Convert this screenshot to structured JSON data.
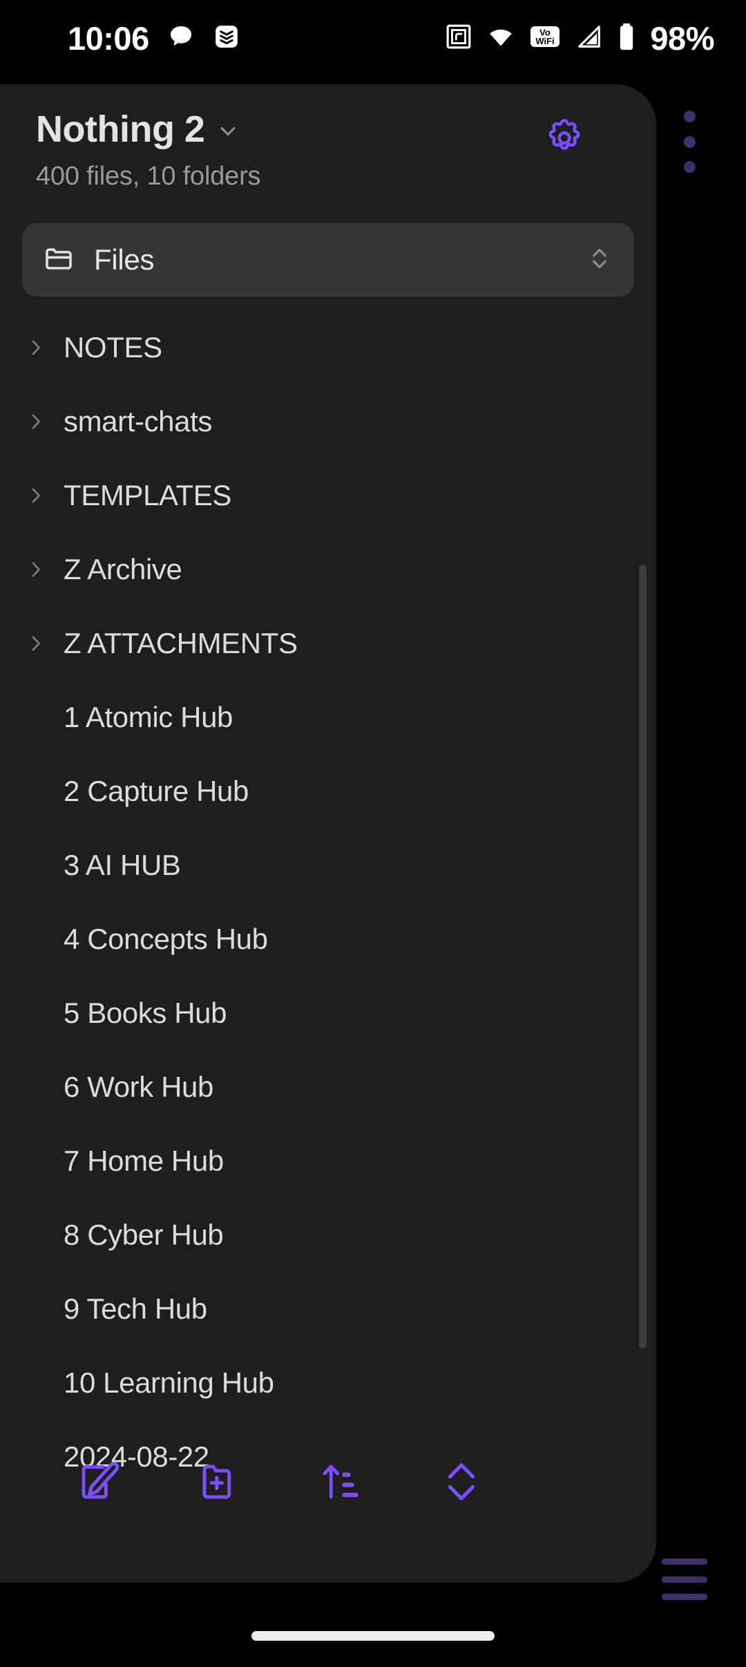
{
  "statusbar": {
    "time": "10:06",
    "battery_percent": "98%",
    "left_icons": [
      "chat-bubble-icon",
      "todoist-icon"
    ],
    "right_icons": [
      "nfc-icon",
      "wifi-icon",
      "vowifi-icon",
      "cellular-signal-icon",
      "battery-icon"
    ],
    "vowifi_line1": "Vo",
    "vowifi_line2": "WiFi"
  },
  "header": {
    "vault_name": "Nothing 2",
    "vault_chevron_icon": "chevron-down-icon",
    "stats": "400 files, 10 folders",
    "settings_icon": "gear-icon",
    "overflow_icon": "kebab-menu-icon"
  },
  "files_selector": {
    "icon": "folder-icon",
    "label": "Files",
    "selector_icon": "chevron-up-down-icon"
  },
  "file_list": {
    "items": [
      {
        "label": "NOTES",
        "type": "folder",
        "icon": "chevron-right-icon"
      },
      {
        "label": "smart-chats",
        "type": "folder",
        "icon": "chevron-right-icon"
      },
      {
        "label": "TEMPLATES",
        "type": "folder",
        "icon": "chevron-right-icon"
      },
      {
        "label": "Z Archive",
        "type": "folder",
        "icon": "chevron-right-icon"
      },
      {
        "label": "Z ATTACHMENTS",
        "type": "folder",
        "icon": "chevron-right-icon"
      },
      {
        "label": "1 Atomic Hub",
        "type": "file",
        "icon": ""
      },
      {
        "label": "2 Capture Hub",
        "type": "file",
        "icon": ""
      },
      {
        "label": "3 AI HUB",
        "type": "file",
        "icon": ""
      },
      {
        "label": "4 Concepts Hub",
        "type": "file",
        "icon": ""
      },
      {
        "label": "5 Books Hub",
        "type": "file",
        "icon": ""
      },
      {
        "label": "6 Work Hub",
        "type": "file",
        "icon": ""
      },
      {
        "label": "7 Home Hub",
        "type": "file",
        "icon": ""
      },
      {
        "label": "8 Cyber Hub",
        "type": "file",
        "icon": ""
      },
      {
        "label": "9 Tech Hub",
        "type": "file",
        "icon": ""
      },
      {
        "label": "10 Learning Hub",
        "type": "file",
        "icon": ""
      },
      {
        "label": "2024-08-22",
        "type": "file",
        "icon": ""
      }
    ]
  },
  "toolbar": {
    "buttons": [
      {
        "name": "new-note-button",
        "icon": "note-edit-icon"
      },
      {
        "name": "new-folder-button",
        "icon": "folder-plus-icon"
      },
      {
        "name": "sort-button",
        "icon": "sort-ascending-icon"
      },
      {
        "name": "expand-collapse-button",
        "icon": "chevron-up-down-icon"
      }
    ],
    "menu_icon": "hamburger-menu-icon"
  },
  "colors": {
    "accent": "#7c4dff",
    "accent_dim": "#3f2f6b",
    "drawer_bg": "#1e1e1e",
    "files_bar_bg": "#353535",
    "text_primary": "#dcdcdc",
    "text_secondary": "#9a9a9a",
    "background": "#000000"
  },
  "navbar": {
    "pill": "gesture-nav-pill"
  }
}
